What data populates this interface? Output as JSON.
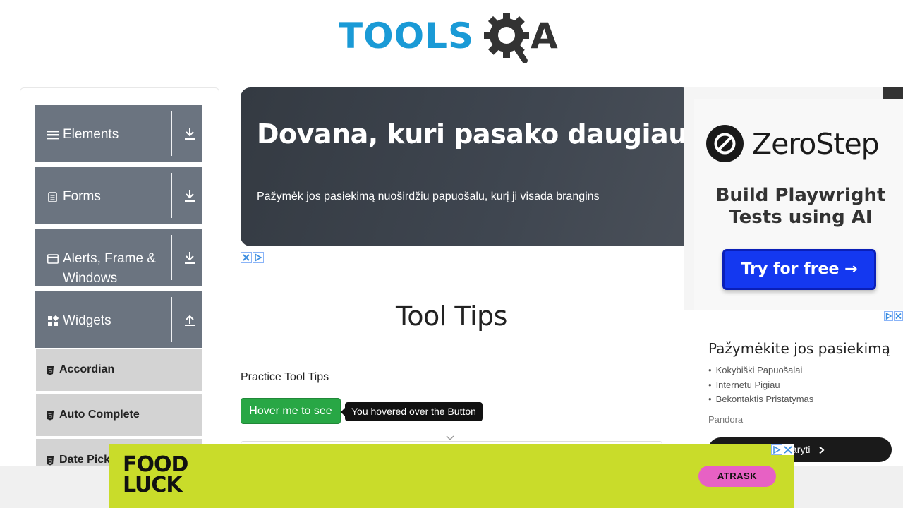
{
  "header": {
    "logo_tools": "TOOLS",
    "logo_a": "A"
  },
  "sidebar": {
    "groups": [
      {
        "label": "Elements",
        "icon": "hamburger-icon",
        "arrow": "download"
      },
      {
        "label": "Forms",
        "icon": "document-icon",
        "arrow": "download"
      },
      {
        "label": "Alerts, Frame & Windows",
        "icon": "window-icon",
        "arrow": "download"
      },
      {
        "label": "Widgets",
        "icon": "grid-icon",
        "arrow": "upload"
      }
    ],
    "items": [
      {
        "label": "Accordian"
      },
      {
        "label": "Auto Complete"
      },
      {
        "label": "Date Pick"
      }
    ]
  },
  "banner": {
    "title": "Dovana, kuri pasako daugiau",
    "text": "Pažymėk jos pasiekimą nuoširdžiu papuošalu, kurį ji visada brangins"
  },
  "main": {
    "page_title": "Tool Tips",
    "practice_label": "Practice Tool Tips",
    "hover_button": "Hover me to see",
    "tooltip": "You hovered over the Button"
  },
  "zerostep": {
    "name": "ZeroStep",
    "subtitle": "Build Playwright Tests using AI",
    "button": "Try for free →"
  },
  "right_ad": {
    "title": "Pažymėkite jos pasiekimą",
    "items": [
      "Kokybiški Papuošalai",
      "Internetu Pigiau",
      "Bekontaktis Pristatymas"
    ],
    "brand": "Pandora",
    "button": "aryti"
  },
  "food_ad": {
    "logo_line1": "FOOD",
    "logo_line2": "LUCK",
    "button": "ATRASK"
  },
  "colors": {
    "group_bg": "#6b7480",
    "item_bg": "#d3d3d3",
    "button_green": "#28a745",
    "logo_blue": "#1a9ad6",
    "food_bg": "#c9dc2a",
    "food_btn": "#e761c4",
    "zs_btn": "#1438f0"
  }
}
